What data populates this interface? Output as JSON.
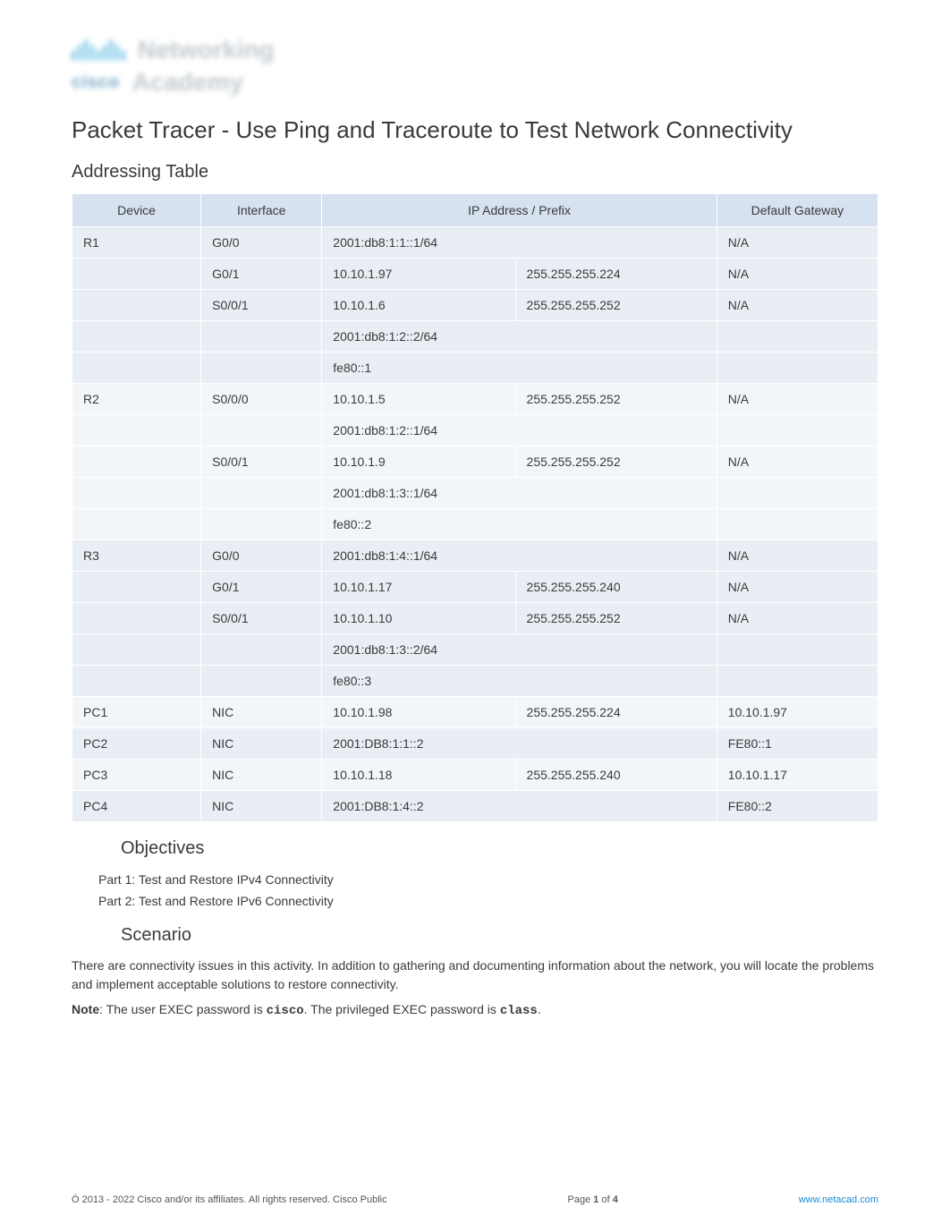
{
  "logo": {
    "line1_brand": "cisco",
    "line1_word": "Networking",
    "line2_word": "Academy"
  },
  "title": "Packet Tracer - Use Ping and Traceroute to Test Network Connectivity",
  "addressing_header": "Addressing Table",
  "table_headers": {
    "device": "Device",
    "interface": "Interface",
    "ip": "IP Address / Prefix",
    "gateway": "Default Gateway"
  },
  "rows": [
    {
      "device": "R1",
      "interface": "G0/0",
      "ip": "2001:db8:1:1::1/64",
      "mask": "",
      "gw": "N/A",
      "red": false,
      "group": "odd"
    },
    {
      "device": "",
      "interface": "G0/1",
      "ip": "10.10.1.97",
      "mask": "255.255.255.224",
      "gw": "N/A",
      "red": false,
      "group": "odd"
    },
    {
      "device": "",
      "interface": "S0/0/1",
      "ip": "10.10.1.6",
      "mask": "255.255.255.252",
      "gw": "N/A",
      "red": false,
      "group": "odd"
    },
    {
      "device": "",
      "interface": "",
      "ip": "2001:db8:1:2::2/64",
      "mask": "",
      "gw": "",
      "red": false,
      "group": "odd"
    },
    {
      "device": "",
      "interface": "",
      "ip": "fe80::1",
      "mask": "",
      "gw": "",
      "red": false,
      "group": "odd"
    },
    {
      "device": "R2",
      "interface": "S0/0/0",
      "ip": "10.10.1.5",
      "mask": "255.255.255.252",
      "gw": "N/A",
      "red": false,
      "group": "even"
    },
    {
      "device": "",
      "interface": "",
      "ip": "2001:db8:1:2::1/64",
      "mask": "",
      "gw": "",
      "red": false,
      "group": "even"
    },
    {
      "device": "",
      "interface": "S0/0/1",
      "ip": "10.10.1.9",
      "mask": "255.255.255.252",
      "gw": "N/A",
      "red": false,
      "group": "even"
    },
    {
      "device": "",
      "interface": "",
      "ip": "2001:db8:1:3::1/64",
      "mask": "",
      "gw": "",
      "red": false,
      "group": "even"
    },
    {
      "device": "",
      "interface": "",
      "ip": "fe80::2",
      "mask": "",
      "gw": "",
      "red": false,
      "group": "even"
    },
    {
      "device": "R3",
      "interface": "G0/0",
      "ip": "2001:db8:1:4::1/64",
      "mask": "",
      "gw": "N/A",
      "red": false,
      "group": "odd"
    },
    {
      "device": "",
      "interface": "G0/1",
      "ip": "10.10.1.17",
      "mask": "255.255.255.240",
      "gw": "N/A",
      "red": false,
      "group": "odd"
    },
    {
      "device": "",
      "interface": "S0/0/1",
      "ip": "10.10.1.10",
      "mask": "255.255.255.252",
      "gw": "N/A",
      "red": false,
      "group": "odd"
    },
    {
      "device": "",
      "interface": "",
      "ip": "2001:db8:1:3::2/64",
      "mask": "",
      "gw": "",
      "red": false,
      "group": "odd"
    },
    {
      "device": "",
      "interface": "",
      "ip": "fe80::3",
      "mask": "",
      "gw": "",
      "red": false,
      "group": "odd"
    },
    {
      "device": "PC1",
      "interface": "NIC",
      "ip": "10.10.1.98",
      "mask": "255.255.255.224",
      "gw": "10.10.1.97",
      "red": true,
      "group": "even"
    },
    {
      "device": "PC2",
      "interface": "NIC",
      "ip": "2001:DB8:1:1::2",
      "mask": "",
      "gw": "FE80::1",
      "red": true,
      "group": "odd"
    },
    {
      "device": "PC3",
      "interface": "NIC",
      "ip": "10.10.1.18",
      "mask": "255.255.255.240",
      "gw": "10.10.1.17",
      "red": true,
      "group": "even"
    },
    {
      "device": "PC4",
      "interface": "NIC",
      "ip": "2001:DB8:1:4::2",
      "mask": "",
      "gw": "FE80::2",
      "red": true,
      "group": "odd"
    }
  ],
  "objectives": {
    "heading": "Objectives",
    "items": [
      "Part 1: Test and Restore IPv4 Connectivity",
      "Part 2: Test and Restore IPv6 Connectivity"
    ]
  },
  "scenario": {
    "heading": "Scenario",
    "body": "There are connectivity issues in this activity. In addition to gathering and documenting information about the network, you will locate the problems and implement acceptable solutions to restore connectivity.",
    "note_prefix": "Note",
    "note_body_1": ": The user EXEC password is ",
    "note_val_1": "cisco",
    "note_body_2": ". The privileged EXEC password is ",
    "note_val_2": "class",
    "note_body_3": "."
  },
  "footer": {
    "copyright_symbol": "Ó",
    "copyright": " 2013 - 2022 Cisco and/or its affiliates. All rights reserved. Cisco Public",
    "page_label": "Page ",
    "page_current": "1",
    "page_of": " of ",
    "page_total": "4",
    "link": "www.netacad.com"
  }
}
